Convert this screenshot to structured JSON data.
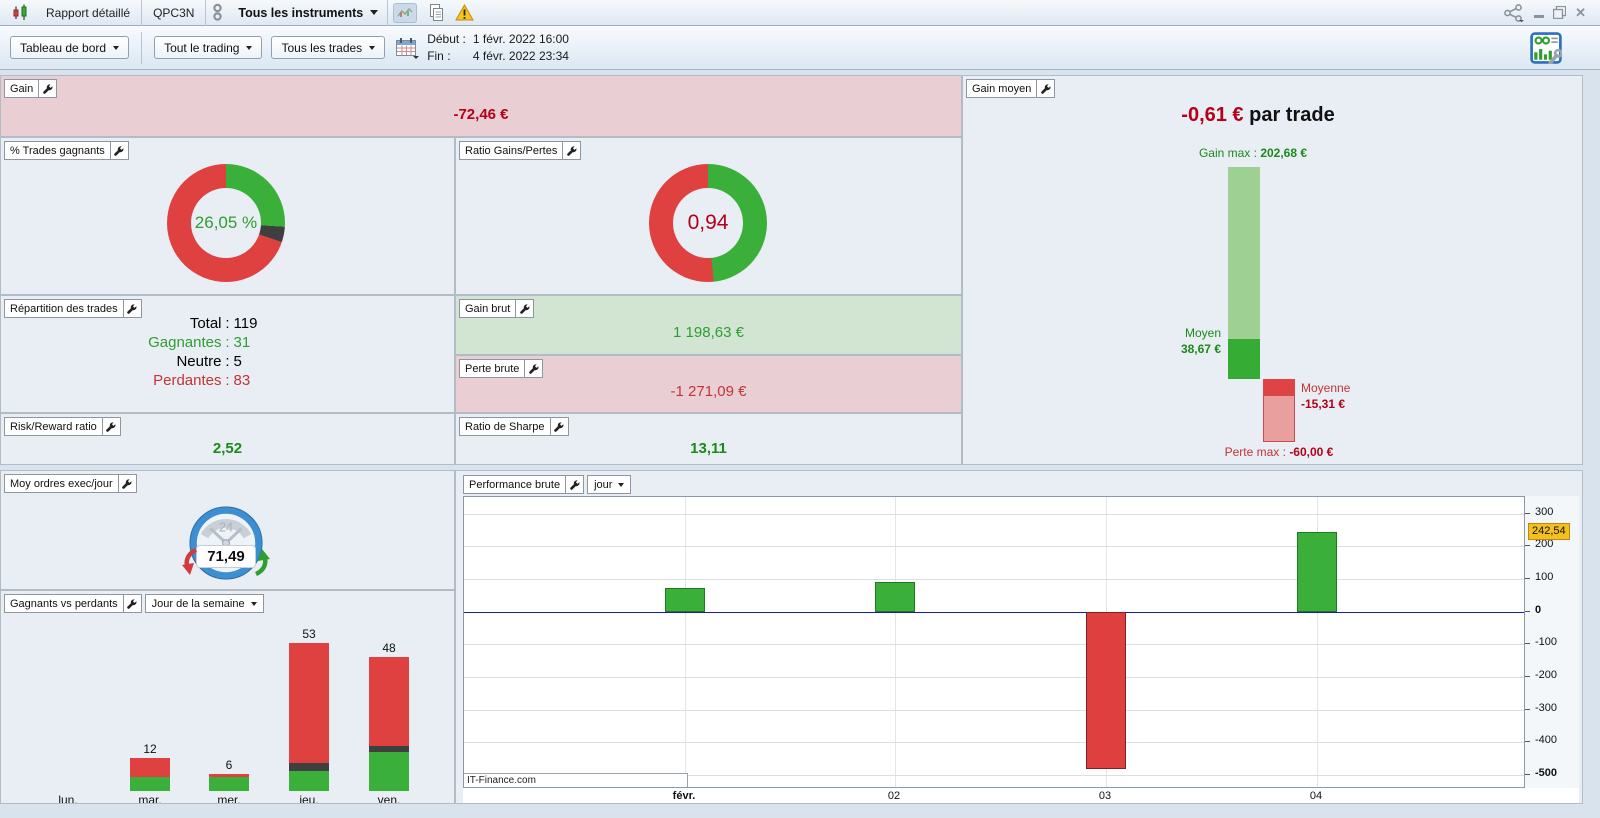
{
  "colors": {
    "positive_green": "#2f9e2f",
    "negative_red": "#b40018",
    "bright_red": "#c43434",
    "donut_green": "#3ab03a",
    "donut_red": "#df4040",
    "neutral_dark": "#3f3f3f",
    "pink_panel_bg": "#e9ced4",
    "green_panel_bg": "#d2e4d2",
    "highlight_badge_bg": "#f3c01e",
    "zero_line_blue": "#1a1ab8"
  },
  "titlebar": {
    "tabs": [
      {
        "label": "Rapport détaillé"
      },
      {
        "label": "QPC3N"
      }
    ],
    "instrument_selector": "Tous les instruments"
  },
  "toolbar": {
    "dashboard_selector": "Tableau de bord",
    "trading_scope_selector": "Tout le trading",
    "trades_filter_selector": "Tous les trades",
    "period_start_label": "Début :",
    "period_start": "1 févr. 2022 16:00",
    "period_end_label": "Fin :",
    "period_end": "4 févr. 2022 23:34"
  },
  "panels": {
    "gain": {
      "label": "Gain",
      "value": "-72,46 €"
    },
    "pct_trades_gagnants": {
      "label": "% Trades gagnants",
      "center_value": "26,05 %"
    },
    "ratio_gains_pertes": {
      "label": "Ratio Gains/Pertes",
      "center_value": "0,94"
    },
    "gain_moyen": {
      "label": "Gain moyen",
      "value": "-0,61 €",
      "value_suffix": " par trade",
      "gain_max_label": "Gain max : ",
      "gain_max_value": "202,68 €",
      "moyen_label": "Moyen",
      "moyen_value": "38,67 €",
      "moyenne_label": "Moyenne",
      "moyenne_value": "-15,31 €",
      "perte_max_label": "Perte max : ",
      "perte_max_value": "-60,00 €"
    },
    "repartition_trades": {
      "label": "Répartition des trades",
      "colon": ":",
      "rows": [
        {
          "name": "Total",
          "value": "119"
        },
        {
          "name": "Gagnantes",
          "value": "31"
        },
        {
          "name": "Neutre",
          "value": "5"
        },
        {
          "name": "Perdantes",
          "value": "83"
        }
      ]
    },
    "gain_brut": {
      "label": "Gain brut",
      "value": "1 198,63 €"
    },
    "perte_brute": {
      "label": "Perte brute",
      "value": "-1 271,09 €"
    },
    "risk_reward": {
      "label": "Risk/Reward ratio",
      "value": "2,52"
    },
    "ratio_sharpe": {
      "label": "Ratio de Sharpe",
      "value": "13,11"
    },
    "moy_ordres": {
      "label": "Moy ordres exec/jour",
      "value": "71,49",
      "clock_badge": "24"
    },
    "gagnants_vs_perdants": {
      "label": "Gagnants vs perdants",
      "selector": "Jour de la semaine"
    },
    "performance_brute": {
      "label": "Performance brute",
      "selector": "jour",
      "watermark": "IT-Finance.com"
    }
  },
  "chart_data": [
    {
      "id": "pct-trades-gagnants-donut",
      "type": "pie",
      "title": "% Trades gagnants",
      "center_label": "26,05 %",
      "slices": [
        {
          "name": "gagnants",
          "pct": 26.05,
          "color": "#3ab03a"
        },
        {
          "name": "neutres",
          "pct": 4.2,
          "color": "#3f3f3f"
        },
        {
          "name": "perdants",
          "pct": 69.75,
          "color": "#df4040"
        }
      ]
    },
    {
      "id": "ratio-gains-pertes-donut",
      "type": "pie",
      "title": "Ratio Gains/Pertes",
      "center_label": "0,94",
      "slices": [
        {
          "name": "gains",
          "pct": 48.45,
          "color": "#3ab03a"
        },
        {
          "name": "pertes",
          "pct": 51.55,
          "color": "#df4040"
        }
      ]
    },
    {
      "id": "gain-moyen-waterfall",
      "type": "bar",
      "title": "Gain moyen (-0,61 € par trade)",
      "points": [
        {
          "key": "gain_max",
          "label": "Gain max",
          "value": 202.68
        },
        {
          "key": "gain_moyen",
          "label": "Moyen",
          "value": 38.67
        },
        {
          "key": "perte_moyenne",
          "label": "Moyenne",
          "value": -15.31
        },
        {
          "key": "perte_max",
          "label": "Perte max",
          "value": -60.0
        }
      ],
      "colors": {
        "gain_light": "#9fd093",
        "gain_dark": "#35ad35",
        "loss_dark": "#df4343",
        "loss_light": "#ea9f9f",
        "loss_light_border": "#c94b4b"
      }
    },
    {
      "id": "gagnants-vs-perdants",
      "type": "bar",
      "title": "Gagnants vs perdants — Jour de la semaine",
      "categories": [
        "lun.",
        "mar.",
        "mer.",
        "jeu.",
        "ven."
      ],
      "series": [
        {
          "name": "gagnants",
          "color": "#3ab03a",
          "values": [
            0,
            5,
            5,
            7,
            14
          ]
        },
        {
          "name": "neutres",
          "color": "#3f3f3f",
          "values": [
            0,
            0,
            0,
            3,
            2
          ]
        },
        {
          "name": "perdants",
          "color": "#df4040",
          "values": [
            0,
            7,
            1,
            43,
            32
          ]
        }
      ],
      "totals": [
        0,
        12,
        6,
        53,
        48
      ]
    },
    {
      "id": "performance-brute",
      "type": "bar",
      "title": "Performance brute — jour",
      "categories": [
        "févr.",
        "02",
        "03",
        "04"
      ],
      "values": [
        73,
        92,
        -480,
        242.54
      ],
      "ylim": [
        -500,
        320
      ],
      "yticks": [
        300,
        200,
        100,
        0,
        -100,
        -200,
        -300,
        -400,
        -500
      ],
      "bold_yticks": [
        0,
        -500
      ],
      "last_value": 242.54,
      "last_value_label": "242,54",
      "zero_line_color": "#1a1ab8",
      "grid": true,
      "bar_colors": {
        "positive": "#3ab03a",
        "negative": "#df3f3f"
      }
    }
  ]
}
